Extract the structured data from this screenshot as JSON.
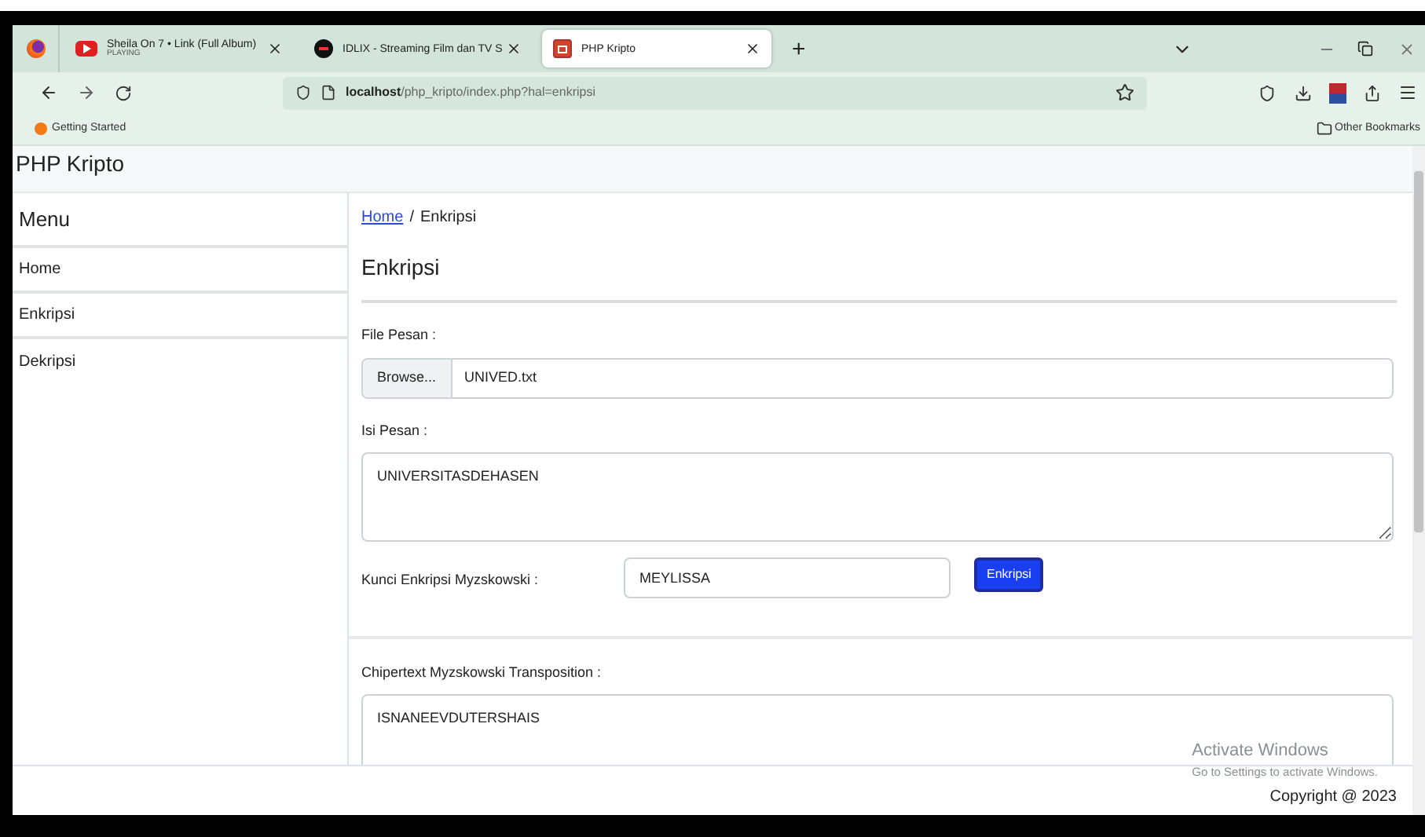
{
  "browser": {
    "tabs": [
      {
        "title": "Sheila On 7 • Link (Full Album)",
        "subtitle": "PLAYING",
        "kind": "video",
        "selected": false
      },
      {
        "title": "IDLIX - Streaming Film dan TV S",
        "kind": "dark",
        "selected": false
      },
      {
        "title": "PHP Kripto",
        "kind": "page",
        "selected": true
      }
    ],
    "new_tab": "+",
    "url_host": "localhost",
    "url_path": "/php_kripto/index.php?hal=enkripsi",
    "bookmarks": [
      "Getting Started"
    ],
    "other_bookmarks": "Other Bookmarks"
  },
  "site": {
    "brand": "PHP Kripto"
  },
  "sidebar": {
    "title": "Menu",
    "items": [
      {
        "label": "Home",
        "selected": false
      },
      {
        "label": "Enkripsi",
        "selected": false
      },
      {
        "label": "Dekripsi",
        "selected": false
      }
    ]
  },
  "breadcrumb": {
    "link": "Home",
    "separator": "/",
    "current": "Enkripsi"
  },
  "heading": "Enkripsi",
  "file_field": {
    "label": "File Pesan :",
    "button": "Browse...",
    "value": "UNIVED.txt"
  },
  "message_field": {
    "label": "Isi Pesan :",
    "value": "UNIVERSITASDEHASEN"
  },
  "key_field": {
    "label": "Kunci Enkripsi Myzskowski :",
    "value": "MEYLISSA",
    "button": "Enkripsi"
  },
  "cipher_field": {
    "label": "Chipertext Myzskowski Transposition :",
    "value": "ISNANEEVDUTERSHAIS"
  },
  "activation": {
    "title": "Activate Windows",
    "text": "Go to Settings to activate Windows."
  },
  "footer": {
    "copyright": "Copyright @ 2023"
  }
}
